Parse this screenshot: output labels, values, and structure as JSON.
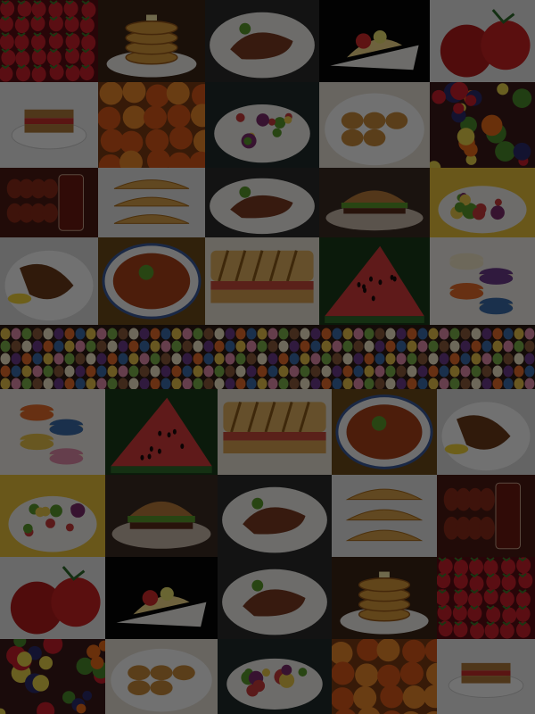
{
  "colors": {
    "page_background": "#0b0b0b",
    "dim_overlay": "rgba(0,0,0,0.55)",
    "plate_white": "#f2f0ec",
    "strawberry_red": "#c8202a",
    "pancake_gold": "#d89a3a",
    "steak_brown": "#7a3a22",
    "salad_green": "#5a9a2a",
    "watermelon_red": "#d23b3b",
    "watermelon_rind": "#2f6b2a",
    "macaron_colors": [
      "#e7c14a",
      "#e08aa8",
      "#7ab04a",
      "#8a5a3a",
      "#f2e6c8",
      "#6a3a8a",
      "#e46a2a",
      "#3a6aa8"
    ]
  },
  "mosaic": {
    "tiles": [
      {
        "icon": "strawberries-icon"
      },
      {
        "icon": "pancake-stack-icon"
      },
      {
        "icon": "steak-plate-icon"
      },
      {
        "icon": "fruit-dessert-plate-icon"
      },
      {
        "icon": "tomatoes-icon"
      },
      {
        "icon": "sandwich-plate-icon"
      },
      {
        "icon": "peaches-icon"
      },
      {
        "icon": "salad-bowl-icon"
      },
      {
        "icon": "dumpling-plate-icon"
      },
      {
        "icon": "mixed-fruit-icon"
      },
      {
        "icon": "sausages-drink-icon"
      },
      {
        "icon": "empanadas-icon"
      },
      {
        "icon": "sliced-meat-plate-icon"
      },
      {
        "icon": "burger-plate-icon"
      },
      {
        "icon": "garnished-plate-icon"
      },
      {
        "icon": "chicken-plate-icon"
      },
      {
        "icon": "soup-bowl-icon"
      },
      {
        "icon": "grilled-sandwich-icon"
      },
      {
        "icon": "watermelon-icon"
      },
      {
        "icon": "macarons-stack-icon"
      },
      {
        "icon": "macaron-rows-icon"
      },
      {
        "icon": "macarons-stack-icon"
      },
      {
        "icon": "watermelon-icon"
      },
      {
        "icon": "grilled-sandwich-icon"
      },
      {
        "icon": "soup-bowl-icon"
      },
      {
        "icon": "chicken-plate-icon"
      },
      {
        "icon": "garnished-plate-icon"
      },
      {
        "icon": "burger-plate-icon"
      },
      {
        "icon": "sliced-meat-plate-icon"
      },
      {
        "icon": "empanadas-icon"
      },
      {
        "icon": "sausages-drink-icon"
      },
      {
        "icon": "tomatoes-icon"
      },
      {
        "icon": "fruit-dessert-plate-icon"
      },
      {
        "icon": "steak-plate-icon"
      },
      {
        "icon": "pancake-stack-icon"
      },
      {
        "icon": "strawberries-icon"
      },
      {
        "icon": "mixed-fruit-icon"
      },
      {
        "icon": "dumpling-plate-icon"
      },
      {
        "icon": "salad-bowl-icon"
      },
      {
        "icon": "peaches-icon"
      },
      {
        "icon": "sandwich-plate-icon"
      }
    ]
  }
}
